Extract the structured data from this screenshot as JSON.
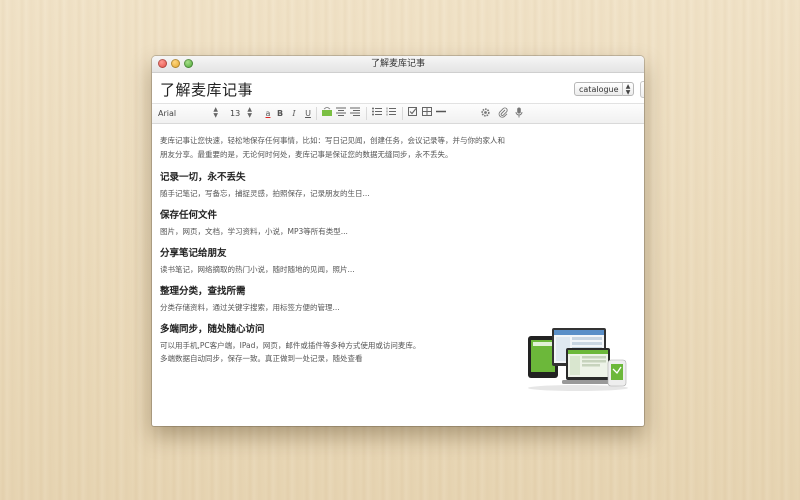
{
  "window": {
    "title": "了解麦库记事"
  },
  "document": {
    "title": "了解麦库记事",
    "catalogue": "catalogue",
    "info_label": "i"
  },
  "toolbar": {
    "font": "Arial",
    "size": "13",
    "text_color_label": "a",
    "bold": "B",
    "italic": "I",
    "underline": "U"
  },
  "content": {
    "intro_line1": "麦库记事让您快速，轻松地保存任何事情，比如：写日记见闻，创建任务，会议记录等，并与你的家人和",
    "intro_line2": "朋友分享。最重要的是，无论何时何处，麦库记事是保证您的数据无缝同步，永不丢失。",
    "sections": [
      {
        "heading": "记录一切，永不丢失",
        "lines": [
          "随手记笔记，写备忘，捕捉灵感，拍照保存，记录朋友的生日..."
        ]
      },
      {
        "heading": "保存任何文件",
        "lines": [
          "图片，网页，文档，学习资料，小说，MP3等所有类型..."
        ]
      },
      {
        "heading": "分享笔记给朋友",
        "lines": [
          "读书笔记，网络摘取的热门小说，随时随地的见闻，照片..."
        ]
      },
      {
        "heading": "整理分类，查找所需",
        "lines": [
          "分类存储资料，通过关键字搜索，用标签方便的管理..."
        ]
      },
      {
        "heading": "多端同步，随处随心访问",
        "lines": [
          "可以用手机,PC客户端，IPad，网页，邮件或插件等多种方式使用或访问麦库。",
          "多端数据自动同步，保存一致。真正做到一处记录，随处查看"
        ]
      }
    ]
  },
  "colors": {
    "wood_background": "#ecdcbd",
    "window_background": "#ffffff",
    "accent_green": "#6cb83a"
  }
}
